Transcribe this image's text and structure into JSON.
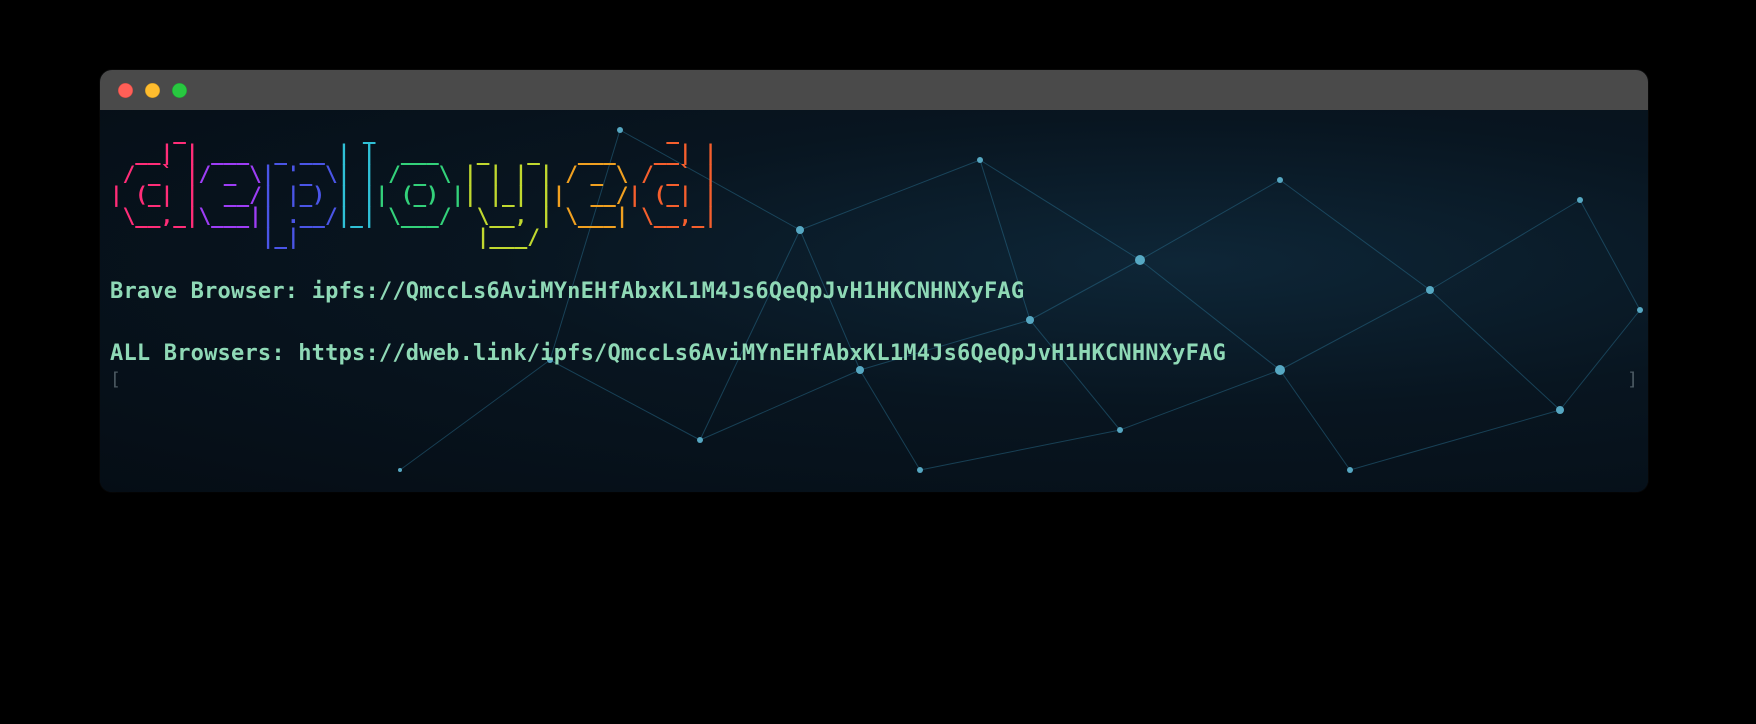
{
  "ascii_word": "deployed",
  "ascii_colors": [
    "#ff2d78",
    "#9d3df5",
    "#4a55e6",
    "#2fc0d6",
    "#33d17a",
    "#c0d82f",
    "#f0a020",
    "#f55f2d"
  ],
  "lines": {
    "brave_label": "Brave Browser: ",
    "brave_url": "ipfs://QmccLs6AviMYnEHfAbxKL1M4Js6QeQpJvH1HKCNHNXyFAG",
    "all_label": "ALL Browsers: ",
    "all_url": "https://dweb.link/ipfs/QmccLs6AviMYnEHfAbxKL1M4Js6QeQpJvH1HKCNHNXyFAG"
  },
  "prompt_left": "[",
  "prompt_right": "]",
  "text_color": "#8fd9b6"
}
